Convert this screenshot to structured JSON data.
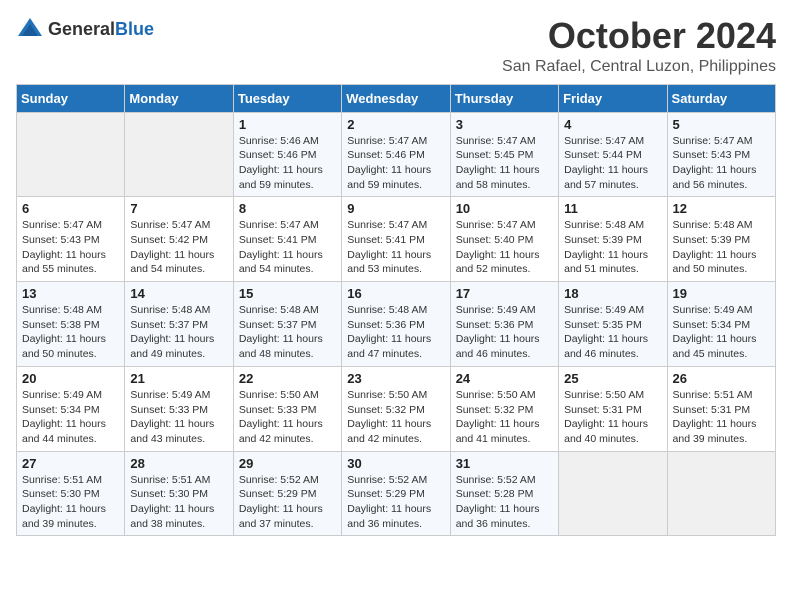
{
  "header": {
    "logo_general": "General",
    "logo_blue": "Blue",
    "month_title": "October 2024",
    "location": "San Rafael, Central Luzon, Philippines"
  },
  "days_of_week": [
    "Sunday",
    "Monday",
    "Tuesday",
    "Wednesday",
    "Thursday",
    "Friday",
    "Saturday"
  ],
  "weeks": [
    [
      {
        "day": "",
        "info": ""
      },
      {
        "day": "",
        "info": ""
      },
      {
        "day": "1",
        "info": "Sunrise: 5:46 AM\nSunset: 5:46 PM\nDaylight: 11 hours\nand 59 minutes."
      },
      {
        "day": "2",
        "info": "Sunrise: 5:47 AM\nSunset: 5:46 PM\nDaylight: 11 hours\nand 59 minutes."
      },
      {
        "day": "3",
        "info": "Sunrise: 5:47 AM\nSunset: 5:45 PM\nDaylight: 11 hours\nand 58 minutes."
      },
      {
        "day": "4",
        "info": "Sunrise: 5:47 AM\nSunset: 5:44 PM\nDaylight: 11 hours\nand 57 minutes."
      },
      {
        "day": "5",
        "info": "Sunrise: 5:47 AM\nSunset: 5:43 PM\nDaylight: 11 hours\nand 56 minutes."
      }
    ],
    [
      {
        "day": "6",
        "info": "Sunrise: 5:47 AM\nSunset: 5:43 PM\nDaylight: 11 hours\nand 55 minutes."
      },
      {
        "day": "7",
        "info": "Sunrise: 5:47 AM\nSunset: 5:42 PM\nDaylight: 11 hours\nand 54 minutes."
      },
      {
        "day": "8",
        "info": "Sunrise: 5:47 AM\nSunset: 5:41 PM\nDaylight: 11 hours\nand 54 minutes."
      },
      {
        "day": "9",
        "info": "Sunrise: 5:47 AM\nSunset: 5:41 PM\nDaylight: 11 hours\nand 53 minutes."
      },
      {
        "day": "10",
        "info": "Sunrise: 5:47 AM\nSunset: 5:40 PM\nDaylight: 11 hours\nand 52 minutes."
      },
      {
        "day": "11",
        "info": "Sunrise: 5:48 AM\nSunset: 5:39 PM\nDaylight: 11 hours\nand 51 minutes."
      },
      {
        "day": "12",
        "info": "Sunrise: 5:48 AM\nSunset: 5:39 PM\nDaylight: 11 hours\nand 50 minutes."
      }
    ],
    [
      {
        "day": "13",
        "info": "Sunrise: 5:48 AM\nSunset: 5:38 PM\nDaylight: 11 hours\nand 50 minutes."
      },
      {
        "day": "14",
        "info": "Sunrise: 5:48 AM\nSunset: 5:37 PM\nDaylight: 11 hours\nand 49 minutes."
      },
      {
        "day": "15",
        "info": "Sunrise: 5:48 AM\nSunset: 5:37 PM\nDaylight: 11 hours\nand 48 minutes."
      },
      {
        "day": "16",
        "info": "Sunrise: 5:48 AM\nSunset: 5:36 PM\nDaylight: 11 hours\nand 47 minutes."
      },
      {
        "day": "17",
        "info": "Sunrise: 5:49 AM\nSunset: 5:36 PM\nDaylight: 11 hours\nand 46 minutes."
      },
      {
        "day": "18",
        "info": "Sunrise: 5:49 AM\nSunset: 5:35 PM\nDaylight: 11 hours\nand 46 minutes."
      },
      {
        "day": "19",
        "info": "Sunrise: 5:49 AM\nSunset: 5:34 PM\nDaylight: 11 hours\nand 45 minutes."
      }
    ],
    [
      {
        "day": "20",
        "info": "Sunrise: 5:49 AM\nSunset: 5:34 PM\nDaylight: 11 hours\nand 44 minutes."
      },
      {
        "day": "21",
        "info": "Sunrise: 5:49 AM\nSunset: 5:33 PM\nDaylight: 11 hours\nand 43 minutes."
      },
      {
        "day": "22",
        "info": "Sunrise: 5:50 AM\nSunset: 5:33 PM\nDaylight: 11 hours\nand 42 minutes."
      },
      {
        "day": "23",
        "info": "Sunrise: 5:50 AM\nSunset: 5:32 PM\nDaylight: 11 hours\nand 42 minutes."
      },
      {
        "day": "24",
        "info": "Sunrise: 5:50 AM\nSunset: 5:32 PM\nDaylight: 11 hours\nand 41 minutes."
      },
      {
        "day": "25",
        "info": "Sunrise: 5:50 AM\nSunset: 5:31 PM\nDaylight: 11 hours\nand 40 minutes."
      },
      {
        "day": "26",
        "info": "Sunrise: 5:51 AM\nSunset: 5:31 PM\nDaylight: 11 hours\nand 39 minutes."
      }
    ],
    [
      {
        "day": "27",
        "info": "Sunrise: 5:51 AM\nSunset: 5:30 PM\nDaylight: 11 hours\nand 39 minutes."
      },
      {
        "day": "28",
        "info": "Sunrise: 5:51 AM\nSunset: 5:30 PM\nDaylight: 11 hours\nand 38 minutes."
      },
      {
        "day": "29",
        "info": "Sunrise: 5:52 AM\nSunset: 5:29 PM\nDaylight: 11 hours\nand 37 minutes."
      },
      {
        "day": "30",
        "info": "Sunrise: 5:52 AM\nSunset: 5:29 PM\nDaylight: 11 hours\nand 36 minutes."
      },
      {
        "day": "31",
        "info": "Sunrise: 5:52 AM\nSunset: 5:28 PM\nDaylight: 11 hours\nand 36 minutes."
      },
      {
        "day": "",
        "info": ""
      },
      {
        "day": "",
        "info": ""
      }
    ]
  ]
}
